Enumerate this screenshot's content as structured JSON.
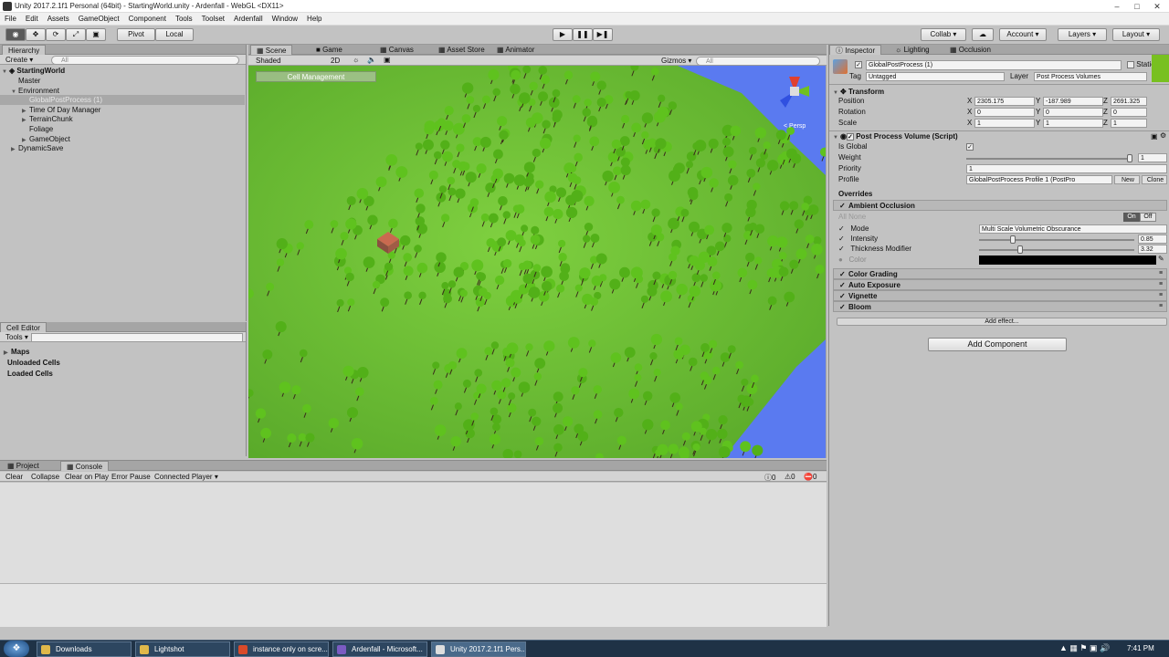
{
  "window": {
    "title": "Unity 2017.2.1f1 Personal (64bit) - StartingWorld.unity - Ardenfall - WebGL <DX11>",
    "minimize": "–",
    "maximize": "□",
    "close": "✕"
  },
  "menu": [
    "File",
    "Edit",
    "Assets",
    "GameObject",
    "Component",
    "Tools",
    "Toolset",
    "Ardenfall",
    "Window",
    "Help"
  ],
  "toolbar": {
    "pivot": "Pivot",
    "local": "Local",
    "collab": "Collab ▾",
    "account": "Account",
    "layers": "Layers",
    "layout": "Layout"
  },
  "hierarchy": {
    "tab": "Hierarchy",
    "create": "Create ▾",
    "search_placeholder": "All",
    "scene": "StartingWorld",
    "items": [
      {
        "label": "Master",
        "depth": 1,
        "arrow": "",
        "selected": false
      },
      {
        "label": "Environment",
        "depth": 1,
        "arrow": "▼",
        "selected": false
      },
      {
        "label": "GlobalPostProcess (1)",
        "depth": 2,
        "arrow": "",
        "selected": true
      },
      {
        "label": "Time Of Day Manager",
        "depth": 2,
        "arrow": "▶",
        "selected": false
      },
      {
        "label": "TerrainChunk",
        "depth": 2,
        "arrow": "▶",
        "selected": false
      },
      {
        "label": "Foliage",
        "depth": 2,
        "arrow": "",
        "selected": false
      },
      {
        "label": "GameObject",
        "depth": 2,
        "arrow": "▶",
        "selected": false
      },
      {
        "label": "DynamicSave",
        "depth": 1,
        "arrow": "▶",
        "selected": false
      }
    ]
  },
  "cell_editor": {
    "tab": "Cell Editor",
    "tools": "Tools ▾",
    "items": [
      "Maps",
      "Unloaded Cells",
      "Loaded Cells"
    ]
  },
  "scene_tabs": {
    "scene": "Scene",
    "game": "Game",
    "canvas": "Canvas",
    "asset_store": "Asset Store",
    "animator": "Animator"
  },
  "scene_toolbar": {
    "shaded": "Shaded",
    "mode2d": "2D",
    "gizmos": "Gizmos ▾",
    "search": "All",
    "cell_management": "Cell Management",
    "persp": "< Persp"
  },
  "console": {
    "project_tab": "Project",
    "console_tab": "Console",
    "clear": "Clear",
    "collapse": "Collapse",
    "clear_on_play": "Clear on Play",
    "error_pause": "Error Pause",
    "connected": "Connected Player ▾",
    "counts": [
      "0",
      "0",
      "0"
    ]
  },
  "inspector": {
    "tabs": [
      "Inspector",
      "Lighting",
      "Occlusion"
    ],
    "object_name": "GlobalPostProcess (1)",
    "static": "Static",
    "tag_label": "Tag",
    "tag": "Untagged",
    "layer_label": "Layer",
    "layer": "Post Process Volumes",
    "transform": {
      "title": "Transform",
      "position": {
        "label": "Position",
        "x": "2305.175",
        "y": "-187.989",
        "z": "2691.325"
      },
      "rotation": {
        "label": "Rotation",
        "x": "0",
        "y": "0",
        "z": "0"
      },
      "scale": {
        "label": "Scale",
        "x": "1",
        "y": "1",
        "z": "1"
      }
    },
    "ppv": {
      "title": "Post Process Volume (Script)",
      "is_global": "Is Global",
      "weight_label": "Weight",
      "weight": "1",
      "weight_fraction": 1.0,
      "priority_label": "Priority",
      "priority": "1",
      "profile_label": "Profile",
      "profile": "GlobalPostProcess Profile 1 (PostPro",
      "new": "New",
      "clone": "Clone"
    },
    "overrides": "Overrides",
    "ao": {
      "title": "Ambient Occlusion",
      "all": "All",
      "none": "None",
      "on": "On",
      "off": "Off",
      "mode_label": "Mode",
      "mode": "Multi Scale Volumetric Obscurance",
      "intensity_label": "Intensity",
      "intensity": "0.85",
      "thickness_label": "Thickness Modifier",
      "thickness": "3.32",
      "color_label": "Color"
    },
    "effects": [
      "Color Grading",
      "Auto Exposure",
      "Vignette",
      "Bloom"
    ],
    "add_effect": "Add effect...",
    "add_component": "Add Component"
  },
  "taskbar": {
    "items": [
      {
        "label": "Downloads",
        "color": "#e0b84a"
      },
      {
        "label": "Lightshot",
        "color": "#e0b84a"
      },
      {
        "label": "instance only on scre...",
        "color": "#d94a2a"
      },
      {
        "label": "Ardenfall - Microsoft...",
        "color": "#7b5bc2"
      },
      {
        "label": "Unity 2017.2.1f1 Pers...",
        "color": "#dddddd"
      }
    ],
    "time": "7:41 PM"
  },
  "colors": {
    "grass": "#78c83a",
    "tree": "#5fc21e",
    "water": "#5a7af0"
  }
}
